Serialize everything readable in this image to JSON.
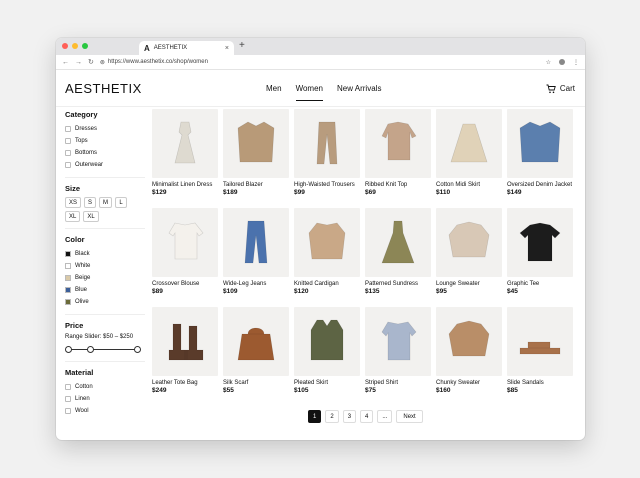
{
  "browser": {
    "tab_title": "AESTHETIX",
    "tab_favicon": "A",
    "url": "https://www.aesthetix.co/shop/women"
  },
  "header": {
    "logo": "AESTHETIX",
    "nav": [
      "Men",
      "Women",
      "New Arrivals"
    ],
    "active_nav": "Women",
    "cart_label": "Cart"
  },
  "filters": {
    "category": {
      "title": "Category",
      "items": [
        "Dresses",
        "Tops",
        "Bottoms",
        "Outerwear"
      ]
    },
    "size": {
      "title": "Size",
      "items": [
        "XS",
        "S",
        "M",
        "L",
        "XL",
        "XL"
      ]
    },
    "color": {
      "title": "Color",
      "items": [
        {
          "label": "Black",
          "hex": "#111111"
        },
        {
          "label": "White",
          "hex": "#ffffff"
        },
        {
          "label": "Beige",
          "hex": "#d9c9a8"
        },
        {
          "label": "Blue",
          "hex": "#3b5f9a"
        },
        {
          "label": "Olive",
          "hex": "#6b6b3a"
        }
      ]
    },
    "price": {
      "title": "Price",
      "range_label": "Range Slider: $50 – $250"
    },
    "material": {
      "title": "Material",
      "items": [
        "Cotton",
        "Linen",
        "Wool"
      ]
    }
  },
  "products": [
    {
      "name": "Minimalist Linen Dress",
      "price": "$129",
      "icon": "dress-icon",
      "color": "#dedad0"
    },
    {
      "name": "Tailored Blazer",
      "price": "$189",
      "icon": "blazer-icon",
      "color": "#b89a78"
    },
    {
      "name": "High-Waisted Trousers",
      "price": "$99",
      "icon": "trousers-icon",
      "color": "#b89c7e"
    },
    {
      "name": "Ribbed Knit Top",
      "price": "$69",
      "icon": "top-icon",
      "color": "#c4a48a"
    },
    {
      "name": "Cotton Midi Skirt",
      "price": "$110",
      "icon": "skirt-icon",
      "color": "#e0d2b8"
    },
    {
      "name": "Oversized Denim Jacket",
      "price": "$149",
      "icon": "jacket-icon",
      "color": "#5b7fae"
    },
    {
      "name": "Crossover Blouse",
      "price": "$89",
      "icon": "blouse-icon",
      "color": "#f4f1ec"
    },
    {
      "name": "Wide-Leg Jeans",
      "price": "$109",
      "icon": "jeans-icon",
      "color": "#4b72ad"
    },
    {
      "name": "Knitted Cardigan",
      "price": "$120",
      "icon": "cardigan-icon",
      "color": "#c9a887"
    },
    {
      "name": "Patterned Sundress",
      "price": "$135",
      "icon": "sundress-icon",
      "color": "#8c8656"
    },
    {
      "name": "Lounge Sweater",
      "price": "$95",
      "icon": "sweater-icon",
      "color": "#d8c8b6"
    },
    {
      "name": "Graphic Tee",
      "price": "$45",
      "icon": "tee-icon",
      "color": "#1c1c1c"
    },
    {
      "name": "Leather Tote Bag",
      "price": "$249",
      "icon": "boots-icon",
      "color": "#5a3b2a"
    },
    {
      "name": "Silk Scarf",
      "price": "$55",
      "icon": "bag-icon",
      "color": "#9c5a30"
    },
    {
      "name": "Pleated Skirt",
      "price": "$105",
      "icon": "vest-icon",
      "color": "#5d6444"
    },
    {
      "name": "Striped Shirt",
      "price": "$75",
      "icon": "shirt-icon",
      "color": "#a9b6cc"
    },
    {
      "name": "Chunky Sweater",
      "price": "$160",
      "icon": "sweater-icon",
      "color": "#b98e68"
    },
    {
      "name": "Slide Sandals",
      "price": "$85",
      "icon": "sandals-icon",
      "color": "#a8714a"
    }
  ],
  "pagination": {
    "pages": [
      "1",
      "2",
      "3",
      "4",
      "..."
    ],
    "active": "1",
    "next_label": "Next"
  }
}
